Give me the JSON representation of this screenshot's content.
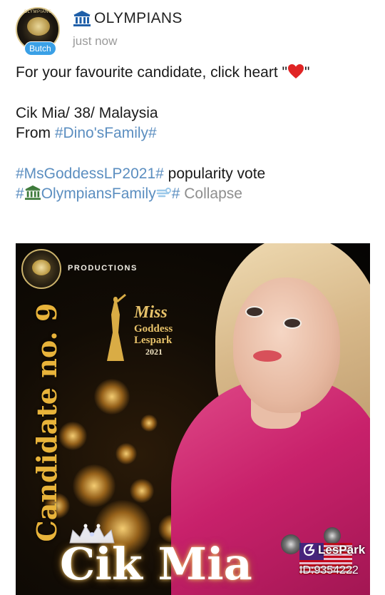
{
  "post": {
    "avatar_badge": "Butch",
    "account_name": "OLYMPIANS",
    "timestamp": "just now",
    "line1_prefix": "For your favourite candidate, click heart \"",
    "line1_suffix": "\"",
    "line2": "Cik Mia/ 38/ Malaysia",
    "line3_prefix": "From ",
    "line3_tag": "#Dino'sFamily#",
    "line4_tag": "#MsGoddessLP2021#",
    "line4_text": " popularity vote",
    "line5_tag_start": "#",
    "line5_tag_name": "OlympiansFamily",
    "line5_tag_end": "#",
    "collapse_label": " Collapse"
  },
  "poster": {
    "logo_text": "OLYMPIANS",
    "productions": "PRODUCTIONS",
    "miss": "Miss",
    "goddess": "Goddess",
    "lespark": "Lespark",
    "year": "2021",
    "candidate_no": "Candidate no. 9",
    "name": "Cik Mia",
    "app_name": "LesPark",
    "user_id": "ID:9354222"
  },
  "colors": {
    "hashtag": "#5b8ec0",
    "collapse": "#8e8e8e",
    "heart": "#e02424",
    "badge": "#3aa0e6",
    "gold": "#e8b33a"
  },
  "icons": [
    "classical-building-icon",
    "red-heart-icon",
    "dash-icon"
  ]
}
